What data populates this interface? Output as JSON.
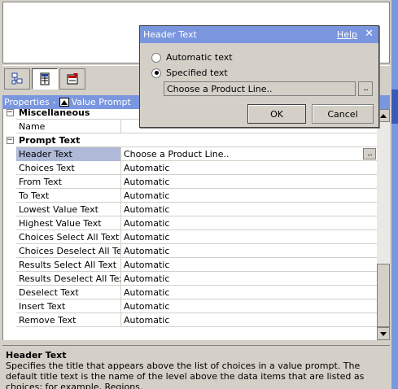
{
  "properties_header": {
    "title": "Properties",
    "separator": "-",
    "context": "Value Prompt"
  },
  "grid": {
    "categories": {
      "miscellaneous": "Miscellaneous",
      "prompt_text": "Prompt Text"
    },
    "misc_rows": [
      {
        "name": "Name",
        "value": ""
      }
    ],
    "prompt_rows": [
      {
        "name": "Header Text",
        "value": "Choose a Product Line.."
      },
      {
        "name": "Choices Text",
        "value": "Automatic"
      },
      {
        "name": "From Text",
        "value": "Automatic"
      },
      {
        "name": "To Text",
        "value": "Automatic"
      },
      {
        "name": "Lowest Value Text",
        "value": "Automatic"
      },
      {
        "name": "Highest Value Text",
        "value": "Automatic"
      },
      {
        "name": "Choices Select All Text",
        "value": "Automatic"
      },
      {
        "name": "Choices Deselect All Text",
        "value": "Automatic"
      },
      {
        "name": "Results Select All Text",
        "value": "Automatic"
      },
      {
        "name": "Results Deselect All Text",
        "value": "Automatic"
      },
      {
        "name": "Deselect Text",
        "value": "Automatic"
      },
      {
        "name": "Insert Text",
        "value": "Automatic"
      },
      {
        "name": "Remove Text",
        "value": "Automatic"
      }
    ],
    "ellipsis": "..."
  },
  "description": {
    "title": "Header Text",
    "text": "Specifies the title that appears above the list of choices in a value prompt. The default title text is the name of the level above the data items that are listed as choices; for example, Regions."
  },
  "dialog": {
    "title": "Header Text",
    "help_label": "Help",
    "close_glyph": "✕",
    "option_automatic": "Automatic text",
    "option_specified": "Specified text",
    "selected_option": "specified",
    "input_value": "Choose a Product Line..",
    "ellipsis": "...",
    "ok_label": "OK",
    "cancel_label": "Cancel"
  },
  "colors": {
    "titlebar": "#7a96df",
    "selected_row": "#aebad7",
    "chrome": "#d4d0c8"
  }
}
